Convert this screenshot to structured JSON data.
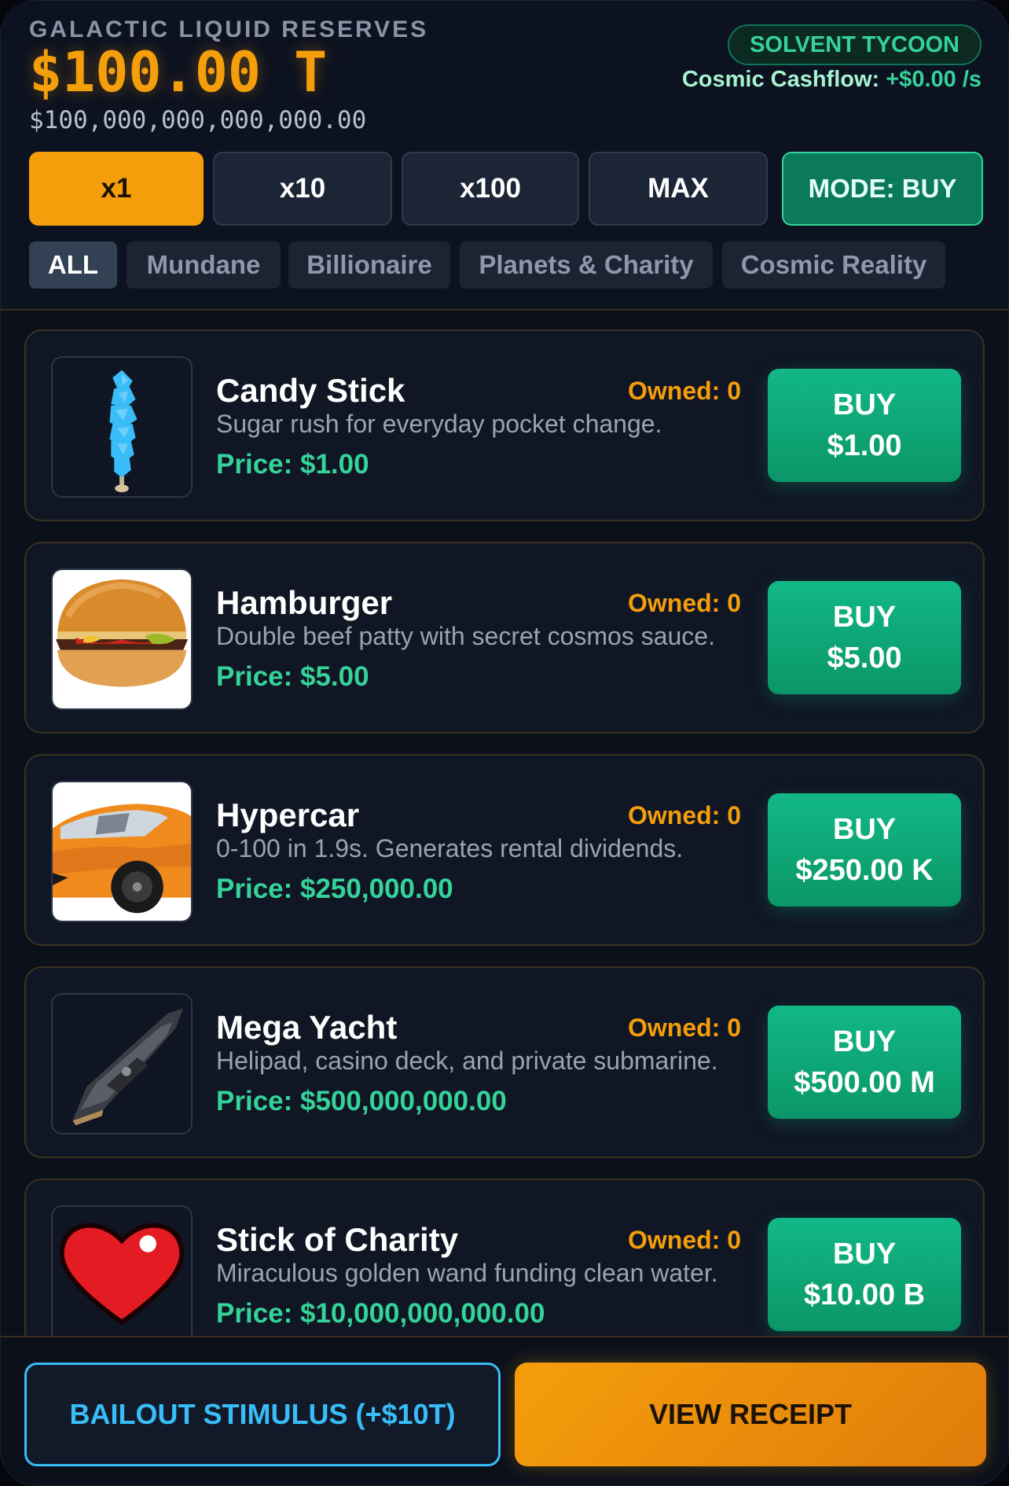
{
  "header": {
    "reserves_label": "GALACTIC LIQUID RESERVES",
    "balance_short": "$100.00 T",
    "balance_full": "$100,000,000,000,000.00",
    "rank_badge": "SOLVENT TYCOON",
    "cashflow_label": "Cosmic Cashflow:",
    "cashflow_rate": "+$0.00 /s"
  },
  "multipliers": {
    "options": [
      "x1",
      "x10",
      "x100",
      "MAX"
    ],
    "selected": "x1",
    "mode_label": "MODE: BUY"
  },
  "categories": {
    "items": [
      "ALL",
      "Mundane",
      "Billionaire",
      "Planets & Charity",
      "Cosmic Reality"
    ],
    "selected": "ALL"
  },
  "items": [
    {
      "name": "Candy Stick",
      "owned": "Owned: 0",
      "description": "Sugar rush for everyday pocket change.",
      "price": "Price: $1.00",
      "buy_label": "BUY",
      "buy_price": "$1.00",
      "icon": "rock-candy-icon"
    },
    {
      "name": "Hamburger",
      "owned": "Owned: 0",
      "description": "Double beef patty with secret cosmos sauce.",
      "price": "Price: $5.00",
      "buy_label": "BUY",
      "buy_price": "$5.00",
      "icon": "hamburger-icon"
    },
    {
      "name": "Hypercar",
      "owned": "Owned: 0",
      "description": "0-100 in 1.9s. Generates rental dividends.",
      "price": "Price: $250,000.00",
      "buy_label": "BUY",
      "buy_price": "$250.00 K",
      "icon": "sports-car-icon"
    },
    {
      "name": "Mega Yacht",
      "owned": "Owned: 0",
      "description": "Helipad, casino deck, and private submarine.",
      "price": "Price: $500,000,000.00",
      "buy_label": "BUY",
      "buy_price": "$500.00 M",
      "icon": "yacht-icon"
    },
    {
      "name": "Stick of Charity",
      "owned": "Owned: 0",
      "description": "Miraculous golden wand funding clean water.",
      "price": "Price: $10,000,000,000.00",
      "buy_label": "BUY",
      "buy_price": "$10.00 B",
      "icon": "heart-icon"
    }
  ],
  "footer": {
    "bailout_label": "BAILOUT STIMULUS (+$10T)",
    "receipt_label": "VIEW RECEIPT"
  },
  "colors": {
    "accent_orange": "#f59e0b",
    "accent_green": "#34d399",
    "accent_blue": "#38bdf8",
    "background": "#0b101b"
  }
}
